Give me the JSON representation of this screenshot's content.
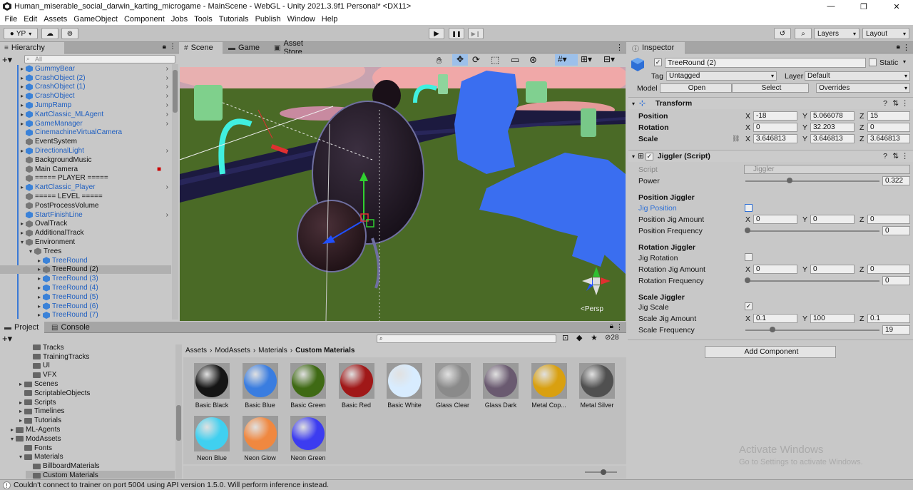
{
  "window": {
    "title": "Human_miserable_social_darwin_karting_microgame - MainScene - WebGL - Unity 2021.3.9f1 Personal* <DX11>",
    "min_icon": "—",
    "max_icon": "❐",
    "close_icon": "✕"
  },
  "menu": [
    "File",
    "Edit",
    "Assets",
    "GameObject",
    "Component",
    "Jobs",
    "Tools",
    "Tutorials",
    "Publish",
    "Window",
    "Help"
  ],
  "toolbar": {
    "account": "YP",
    "layers": "Layers",
    "layout": "Layout",
    "play_icon": "▶",
    "pause_icon": "❚❚",
    "step_icon": "▶❙"
  },
  "hierarchy": {
    "tab": "Hierarchy",
    "search_placeholder": "All",
    "add": "+",
    "items": [
      {
        "label": "GummyBear",
        "blue": true,
        "arrow": "▸",
        "indent": 1,
        "more": true
      },
      {
        "label": "CrashObject (2)",
        "blue": true,
        "arrow": "▸",
        "indent": 1,
        "more": true
      },
      {
        "label": "CrashObject (1)",
        "blue": true,
        "arrow": "▸",
        "indent": 1,
        "more": true
      },
      {
        "label": "CrashObject",
        "blue": true,
        "arrow": "▸",
        "indent": 1,
        "more": true
      },
      {
        "label": "JumpRamp",
        "blue": true,
        "arrow": "▸",
        "indent": 1,
        "more": true
      },
      {
        "label": "KartClassic_MLAgent",
        "blue": true,
        "arrow": "▸",
        "indent": 1,
        "more": true
      },
      {
        "label": "GameManager",
        "blue": true,
        "arrow": "▸",
        "indent": 1,
        "more": true
      },
      {
        "label": "CinemachineVirtualCamera",
        "blue": true,
        "arrow": "",
        "indent": 1,
        "more": false
      },
      {
        "label": "EventSystem",
        "blue": false,
        "arrow": "",
        "indent": 1,
        "more": false
      },
      {
        "label": "DirectionalLight",
        "blue": true,
        "arrow": "▸",
        "indent": 1,
        "more": true
      },
      {
        "label": "BackgroundMusic",
        "blue": false,
        "arrow": "",
        "indent": 1,
        "more": false
      },
      {
        "label": "Main Camera",
        "blue": false,
        "arrow": "",
        "indent": 1,
        "more": false,
        "cam": true
      },
      {
        "label": "===== PLAYER =====",
        "blue": false,
        "arrow": "",
        "indent": 1,
        "more": false
      },
      {
        "label": "KartClassic_Player",
        "blue": true,
        "arrow": "▸",
        "indent": 1,
        "more": true
      },
      {
        "label": "===== LEVEL =====",
        "blue": false,
        "arrow": "",
        "indent": 1,
        "more": false
      },
      {
        "label": "PostProcessVolume",
        "blue": false,
        "arrow": "",
        "indent": 1,
        "more": false
      },
      {
        "label": "StartFinishLine",
        "blue": true,
        "arrow": "",
        "indent": 1,
        "more": true
      },
      {
        "label": "OvalTrack",
        "blue": false,
        "arrow": "▸",
        "indent": 1,
        "more": false
      },
      {
        "label": "AdditionalTrack",
        "blue": false,
        "arrow": "▸",
        "indent": 1,
        "more": false
      },
      {
        "label": "Environment",
        "blue": false,
        "arrow": "▾",
        "indent": 1,
        "more": false
      },
      {
        "label": "Trees",
        "blue": false,
        "arrow": "▾",
        "indent": 2,
        "more": false
      },
      {
        "label": "TreeRound",
        "blue": true,
        "arrow": "▸",
        "indent": 3,
        "more": false
      },
      {
        "label": "TreeRound (2)",
        "blue": false,
        "arrow": "▸",
        "indent": 3,
        "more": false,
        "selected": true
      },
      {
        "label": "TreeRound (3)",
        "blue": true,
        "arrow": "▸",
        "indent": 3,
        "more": false
      },
      {
        "label": "TreeRound (4)",
        "blue": true,
        "arrow": "▸",
        "indent": 3,
        "more": false
      },
      {
        "label": "TreeRound (5)",
        "blue": true,
        "arrow": "▸",
        "indent": 3,
        "more": false
      },
      {
        "label": "TreeRound (6)",
        "blue": true,
        "arrow": "▸",
        "indent": 3,
        "more": false
      },
      {
        "label": "TreeRound (7)",
        "blue": true,
        "arrow": "▸",
        "indent": 3,
        "more": false
      }
    ]
  },
  "scene": {
    "tabs": [
      {
        "label": "Scene",
        "icon": "#"
      },
      {
        "label": "Game",
        "icon": "▬"
      },
      {
        "label": "Asset Store",
        "icon": "▣"
      }
    ],
    "persp": "<Persp",
    "gizmo_labels": {
      "y": "y",
      "x": "x",
      "z": "z"
    }
  },
  "inspector": {
    "tab": "Inspector",
    "object_name": "TreeRound (2)",
    "static_label": "Static",
    "tag_label": "Tag",
    "tag_value": "Untagged",
    "layer_label": "Layer",
    "layer_value": "Default",
    "model_label": "Model",
    "open": "Open",
    "select": "Select",
    "overrides": "Overrides",
    "transform": {
      "title": "Transform",
      "position": {
        "label": "Position",
        "x": "-18",
        "y": "5.066078",
        "z": "15"
      },
      "rotation": {
        "label": "Rotation",
        "x": "0",
        "y": "32.203",
        "z": "0"
      },
      "scale": {
        "label": "Scale",
        "x": "3.646813",
        "y": "3.646813",
        "z": "3.646813"
      }
    },
    "jiggler": {
      "title": "Jiggler (Script)",
      "script_label": "Script",
      "script_value": "Jiggler",
      "power_label": "Power",
      "power_value": "0.322",
      "power_frac": 0.32,
      "pos_header": "Position Jiggler",
      "jig_position": "Jig Position",
      "pos_amount": {
        "label": "Position Jig Amount",
        "x": "0",
        "y": "0",
        "z": "0"
      },
      "pos_freq": {
        "label": "Position Frequency",
        "value": "0",
        "frac": 0
      },
      "rot_header": "Rotation Jiggler",
      "jig_rotation": "Jig Rotation",
      "rot_amount": {
        "label": "Rotation Jig Amount",
        "x": "0",
        "y": "0",
        "z": "0"
      },
      "rot_freq": {
        "label": "Rotation Frequency",
        "value": "0",
        "frac": 0
      },
      "scale_header": "Scale Jiggler",
      "jig_scale": "Jig Scale",
      "scale_amount": {
        "label": "Scale Jig Amount",
        "x": "0.1",
        "y": "100",
        "z": "0.1"
      },
      "scale_freq": {
        "label": "Scale Frequency",
        "value": "19",
        "frac": 0.19
      }
    },
    "add_component": "Add Component",
    "x": "X",
    "y": "Y",
    "z": "Z",
    "check": "✓"
  },
  "project": {
    "tabs": [
      "Project",
      "Console"
    ],
    "add": "+",
    "badge": "28",
    "tree": [
      {
        "label": "Tracks",
        "indent": 3,
        "arrow": ""
      },
      {
        "label": "TrainingTracks",
        "indent": 3,
        "arrow": ""
      },
      {
        "label": "UI",
        "indent": 3,
        "arrow": ""
      },
      {
        "label": "VFX",
        "indent": 3,
        "arrow": ""
      },
      {
        "label": "Scenes",
        "indent": 2,
        "arrow": "▸"
      },
      {
        "label": "ScriptableObjects",
        "indent": 2,
        "arrow": ""
      },
      {
        "label": "Scripts",
        "indent": 2,
        "arrow": "▸"
      },
      {
        "label": "Timelines",
        "indent": 2,
        "arrow": "▸"
      },
      {
        "label": "Tutorials",
        "indent": 2,
        "arrow": "▸"
      },
      {
        "label": "ML-Agents",
        "indent": 1,
        "arrow": "▸"
      },
      {
        "label": "ModAssets",
        "indent": 1,
        "arrow": "▾"
      },
      {
        "label": "Fonts",
        "indent": 2,
        "arrow": ""
      },
      {
        "label": "Materials",
        "indent": 2,
        "arrow": "▾"
      },
      {
        "label": "BillboardMaterials",
        "indent": 3,
        "arrow": ""
      },
      {
        "label": "Custom Materials",
        "indent": 3,
        "arrow": "",
        "selected": true
      }
    ],
    "breadcrumb": [
      "Assets",
      "ModAssets",
      "Materials",
      "Custom Materials"
    ],
    "materials": [
      {
        "label": "Basic Black",
        "color": "#151515"
      },
      {
        "label": "Basic Blue",
        "color": "#3a7de0"
      },
      {
        "label": "Basic Green",
        "color": "#3f6a14"
      },
      {
        "label": "Basic Red",
        "color": "#a01818"
      },
      {
        "label": "Basic White",
        "color": "#d8ecff"
      },
      {
        "label": "Glass Clear",
        "color": "#8a8a8a"
      },
      {
        "label": "Glass Dark",
        "color": "#6a5a70"
      },
      {
        "label": "Metal Cop...",
        "color": "#d9a010"
      },
      {
        "label": "Metal Silver",
        "color": "#505050"
      },
      {
        "label": "Neon Blue",
        "color": "#40d0f0"
      },
      {
        "label": "Neon Glow",
        "color": "#f08840"
      },
      {
        "label": "Neon Green",
        "color": "#3c3cf0"
      }
    ]
  },
  "status": {
    "icon": "!",
    "message": "Couldn't connect to trainer on port 5004 using API version 1.5.0. Will perform inference instead."
  },
  "watermark": {
    "line1": "Activate Windows",
    "line2": "Go to Settings to activate Windows."
  }
}
